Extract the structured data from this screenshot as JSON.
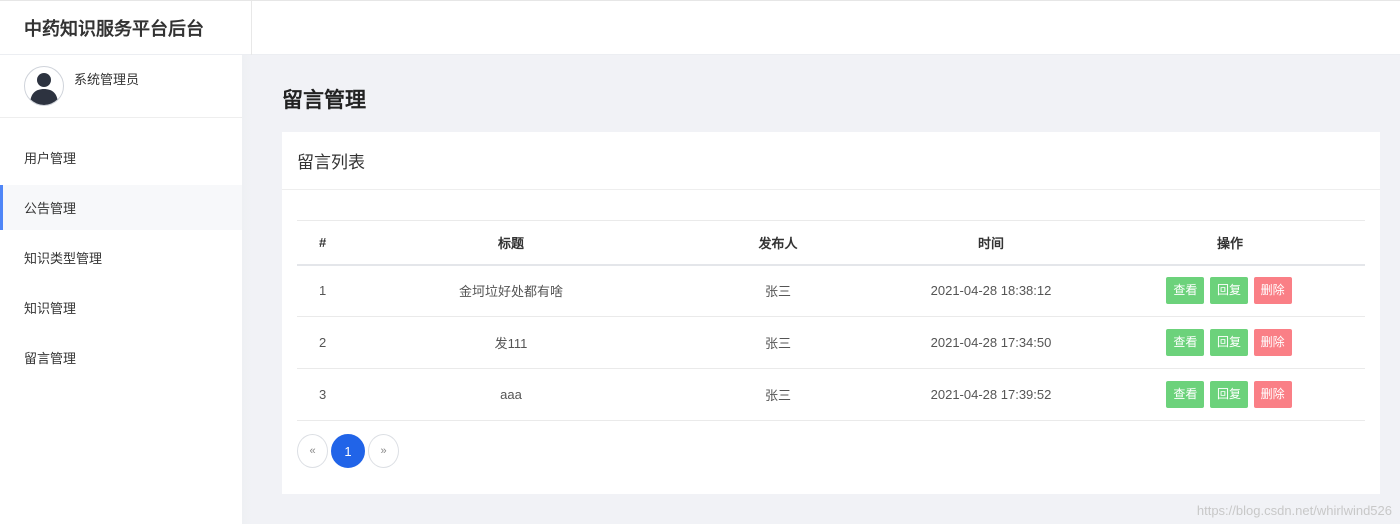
{
  "app": {
    "title": "中药知识服务平台后台"
  },
  "user": {
    "name": "系统管理员"
  },
  "sidebar": {
    "items": [
      {
        "label": "用户管理"
      },
      {
        "label": "公告管理"
      },
      {
        "label": "知识类型管理"
      },
      {
        "label": "知识管理"
      },
      {
        "label": "留言管理"
      }
    ]
  },
  "page": {
    "title": "留言管理"
  },
  "card": {
    "title": "留言列表"
  },
  "table": {
    "headers": [
      "#",
      "标题",
      "发布人",
      "时间",
      "操作"
    ],
    "rows": [
      {
        "id": "1",
        "title": "金坷垃好处都有啥",
        "author": "张三",
        "time": "2021-04-28 18:38:12"
      },
      {
        "id": "2",
        "title": "发111",
        "author": "张三",
        "time": "2021-04-28 17:34:50"
      },
      {
        "id": "3",
        "title": "aaa",
        "author": "张三",
        "time": "2021-04-28 17:39:52"
      }
    ],
    "actions": {
      "view": "查看",
      "reply": "回复",
      "delete": "删除"
    }
  },
  "pagination": {
    "prev": "«",
    "current": "1",
    "next": "»"
  },
  "watermark": "https://blog.csdn.net/whirlwind526",
  "colors": {
    "accent": "#2164e8",
    "green": "#6cd27b",
    "red": "#fa7f86",
    "active_bar": "#4f86f7"
  }
}
